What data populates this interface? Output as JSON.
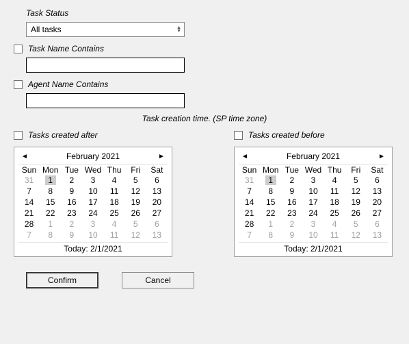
{
  "labels": {
    "task_status": "Task Status",
    "task_name_contains": "Task Name Contains",
    "agent_name_contains": "Agent Name Contains",
    "creation_time": "Task creation time. (SP time zone)",
    "tasks_created_after": "Tasks created after",
    "tasks_created_before": "Tasks created before"
  },
  "dropdown": {
    "status_value": "All tasks"
  },
  "inputs": {
    "task_name_value": "",
    "agent_name_value": ""
  },
  "checkboxes": {
    "task_name": false,
    "agent_name": false,
    "created_after": false,
    "created_before": false
  },
  "calendar_after": {
    "title": "February 2021",
    "dow": [
      "Sun",
      "Mon",
      "Tue",
      "Wed",
      "Thu",
      "Fri",
      "Sat"
    ],
    "today_label": "Today: 2/1/2021",
    "selected_day": 1,
    "weeks": [
      [
        {
          "d": 31,
          "dim": true
        },
        {
          "d": 1,
          "sel": true
        },
        {
          "d": 2
        },
        {
          "d": 3
        },
        {
          "d": 4
        },
        {
          "d": 5
        },
        {
          "d": 6
        }
      ],
      [
        {
          "d": 7
        },
        {
          "d": 8
        },
        {
          "d": 9
        },
        {
          "d": 10
        },
        {
          "d": 11
        },
        {
          "d": 12
        },
        {
          "d": 13
        }
      ],
      [
        {
          "d": 14
        },
        {
          "d": 15
        },
        {
          "d": 16
        },
        {
          "d": 17
        },
        {
          "d": 18
        },
        {
          "d": 19
        },
        {
          "d": 20
        }
      ],
      [
        {
          "d": 21
        },
        {
          "d": 22
        },
        {
          "d": 23
        },
        {
          "d": 24
        },
        {
          "d": 25
        },
        {
          "d": 26
        },
        {
          "d": 27
        }
      ],
      [
        {
          "d": 28
        },
        {
          "d": 1,
          "dim": true
        },
        {
          "d": 2,
          "dim": true
        },
        {
          "d": 3,
          "dim": true
        },
        {
          "d": 4,
          "dim": true
        },
        {
          "d": 5,
          "dim": true
        },
        {
          "d": 6,
          "dim": true
        }
      ],
      [
        {
          "d": 7,
          "dim": true
        },
        {
          "d": 8,
          "dim": true
        },
        {
          "d": 9,
          "dim": true
        },
        {
          "d": 10,
          "dim": true
        },
        {
          "d": 11,
          "dim": true
        },
        {
          "d": 12,
          "dim": true
        },
        {
          "d": 13,
          "dim": true
        }
      ]
    ]
  },
  "calendar_before": {
    "title": "February 2021",
    "dow": [
      "Sun",
      "Mon",
      "Tue",
      "Wed",
      "Thu",
      "Fri",
      "Sat"
    ],
    "today_label": "Today: 2/1/2021",
    "selected_day": 1,
    "weeks": [
      [
        {
          "d": 31,
          "dim": true
        },
        {
          "d": 1,
          "sel": true
        },
        {
          "d": 2
        },
        {
          "d": 3
        },
        {
          "d": 4
        },
        {
          "d": 5
        },
        {
          "d": 6
        }
      ],
      [
        {
          "d": 7
        },
        {
          "d": 8
        },
        {
          "d": 9
        },
        {
          "d": 10
        },
        {
          "d": 11
        },
        {
          "d": 12
        },
        {
          "d": 13
        }
      ],
      [
        {
          "d": 14
        },
        {
          "d": 15
        },
        {
          "d": 16
        },
        {
          "d": 17
        },
        {
          "d": 18
        },
        {
          "d": 19
        },
        {
          "d": 20
        }
      ],
      [
        {
          "d": 21
        },
        {
          "d": 22
        },
        {
          "d": 23
        },
        {
          "d": 24
        },
        {
          "d": 25
        },
        {
          "d": 26
        },
        {
          "d": 27
        }
      ],
      [
        {
          "d": 28
        },
        {
          "d": 1,
          "dim": true
        },
        {
          "d": 2,
          "dim": true
        },
        {
          "d": 3,
          "dim": true
        },
        {
          "d": 4,
          "dim": true
        },
        {
          "d": 5,
          "dim": true
        },
        {
          "d": 6,
          "dim": true
        }
      ],
      [
        {
          "d": 7,
          "dim": true
        },
        {
          "d": 8,
          "dim": true
        },
        {
          "d": 9,
          "dim": true
        },
        {
          "d": 10,
          "dim": true
        },
        {
          "d": 11,
          "dim": true
        },
        {
          "d": 12,
          "dim": true
        },
        {
          "d": 13,
          "dim": true
        }
      ]
    ]
  },
  "buttons": {
    "confirm": "Confirm",
    "cancel": "Cancel"
  }
}
